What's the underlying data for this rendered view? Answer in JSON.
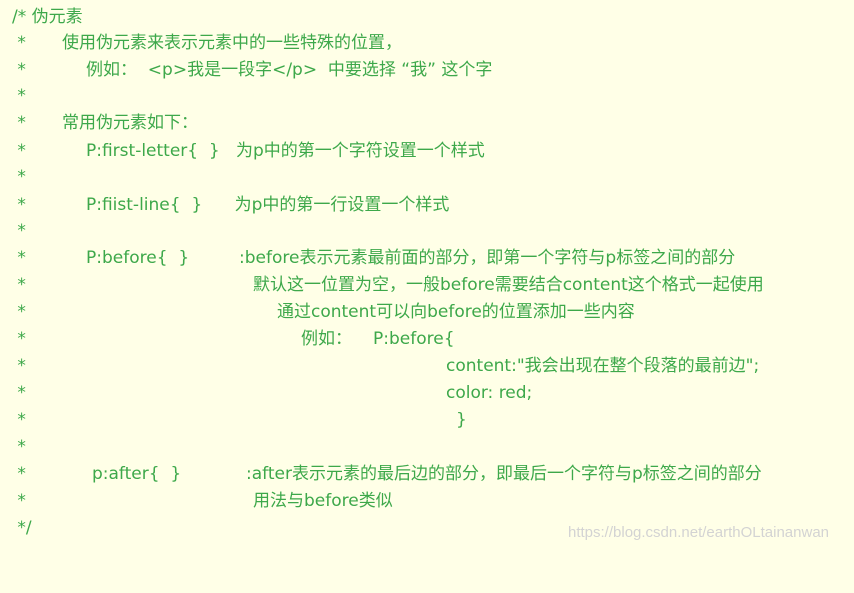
{
  "lines": [
    [
      "/* 伪元素"
    ],
    [
      " *",
      "使用伪元素来表示元素中的一些特殊的位置，"
    ],
    [
      " *",
      "例如：  <p>我是一段字</p>  中要选择 “我” 这个字"
    ],
    [
      " *"
    ],
    [
      " *",
      "常用伪元素如下："
    ],
    [
      " *",
      "P:first-letter{  }   为p中的第一个字符设置一个样式"
    ],
    [
      " *"
    ],
    [
      " *",
      "P:fiist-line{  }      为p中的第一行设置一个样式"
    ],
    [
      " *"
    ],
    [
      " *",
      "P:before{  }",
      ":before表示元素最前面的部分，即第一个字符与p标签之间的部分"
    ],
    [
      " *",
      "默认这一位置为空，一般before需要结合content这个格式一起使用"
    ],
    [
      " *",
      "通过content可以向before的位置添加一些内容"
    ],
    [
      " *",
      "例如：",
      "P:before{"
    ],
    [
      " *",
      "content:\"我会出现在整个段落的最前边\";"
    ],
    [
      " *",
      "color: red;"
    ],
    [
      " *",
      "}"
    ],
    [
      " *"
    ],
    [
      " *",
      "p:after{  }",
      ":after表示元素的最后边的部分，即最后一个字符与p标签之间的部分"
    ],
    [
      " *",
      "用法与before类似"
    ],
    [
      " */"
    ]
  ],
  "watermark": "https://blog.csdn.net/earthOLtainanwan",
  "colors": {
    "background": "#FFFFE7",
    "comment_text": "#3DA84A",
    "watermark": "#D3D3D3"
  }
}
